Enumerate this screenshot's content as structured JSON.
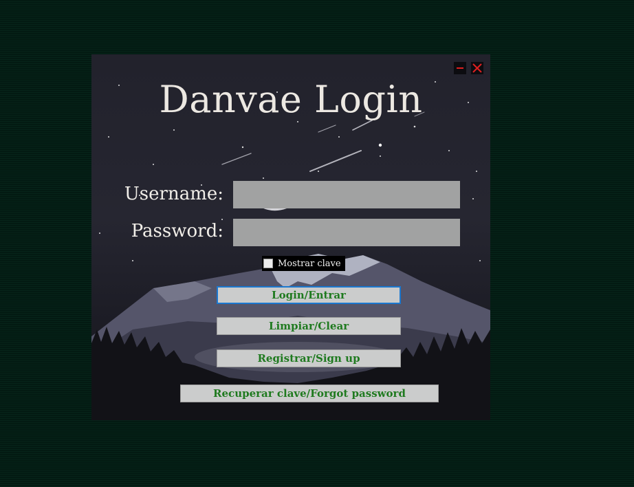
{
  "window": {
    "title": "Danvae Login",
    "controls": {
      "minimize_icon": "minimize-icon",
      "close_icon": "close-icon"
    }
  },
  "form": {
    "username_label": "Username:",
    "username_value": "",
    "password_label": "Password:",
    "password_value": "",
    "show_password_label": "Mostrar clave",
    "show_password_checked": false
  },
  "buttons": {
    "login": "Login/Entrar",
    "clear": "Limpiar/Clear",
    "signup": "Registrar/Sign up",
    "recover": "Recuperar clave/Forgot password"
  },
  "colors": {
    "background": "#031a12",
    "button_text": "#1f7a1f",
    "button_bg": "#cbcccc",
    "focus_border": "#1b78d0",
    "close_icon": "#e02020",
    "minimize_icon": "#e02020",
    "field_bg": "#a1a2a2"
  }
}
